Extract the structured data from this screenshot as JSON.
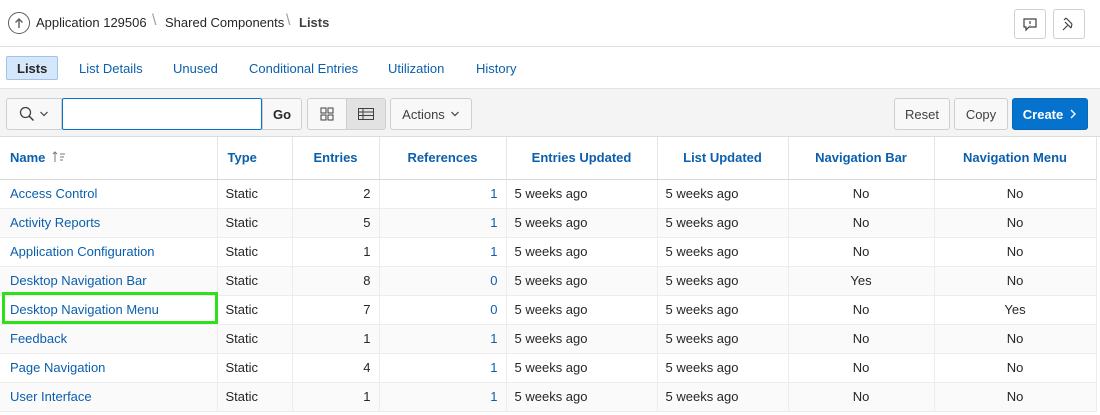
{
  "breadcrumb": {
    "items": [
      "Application 129506",
      "Shared Components",
      "Lists"
    ],
    "separator": "\\"
  },
  "header_icons": [
    "up-arrow-icon",
    "feedback-icon",
    "pin-icon"
  ],
  "tabs": [
    {
      "label": "Lists",
      "active": true
    },
    {
      "label": "List Details",
      "active": false
    },
    {
      "label": "Unused",
      "active": false
    },
    {
      "label": "Conditional Entries",
      "active": false
    },
    {
      "label": "Utilization",
      "active": false
    },
    {
      "label": "History",
      "active": false
    }
  ],
  "toolbar": {
    "search_value": "",
    "search_placeholder": "",
    "go_label": "Go",
    "actions_label": "Actions",
    "reset_label": "Reset",
    "copy_label": "Copy",
    "create_label": "Create",
    "view_mode": "report",
    "accent_color": "#0572ce"
  },
  "table": {
    "columns": [
      "Name",
      "Type",
      "Entries",
      "References",
      "Entries Updated",
      "List Updated",
      "Navigation Bar",
      "Navigation Menu"
    ],
    "sort_column": "Name",
    "sort_direction": "ascending",
    "rows": [
      {
        "name": "Access Control",
        "type": "Static",
        "entries": "2",
        "references": "1",
        "entries_updated": "5 weeks ago",
        "list_updated": "5 weeks ago",
        "nav_bar": "No",
        "nav_menu": "No"
      },
      {
        "name": "Activity Reports",
        "type": "Static",
        "entries": "5",
        "references": "1",
        "entries_updated": "5 weeks ago",
        "list_updated": "5 weeks ago",
        "nav_bar": "No",
        "nav_menu": "No"
      },
      {
        "name": "Application Configuration",
        "type": "Static",
        "entries": "1",
        "references": "1",
        "entries_updated": "5 weeks ago",
        "list_updated": "5 weeks ago",
        "nav_bar": "No",
        "nav_menu": "No"
      },
      {
        "name": "Desktop Navigation Bar",
        "type": "Static",
        "entries": "8",
        "references": "0",
        "entries_updated": "5 weeks ago",
        "list_updated": "5 weeks ago",
        "nav_bar": "Yes",
        "nav_menu": "No"
      },
      {
        "name": "Desktop Navigation Menu",
        "type": "Static",
        "entries": "7",
        "references": "0",
        "entries_updated": "5 weeks ago",
        "list_updated": "5 weeks ago",
        "nav_bar": "No",
        "nav_menu": "Yes",
        "highlighted": true
      },
      {
        "name": "Feedback",
        "type": "Static",
        "entries": "1",
        "references": "1",
        "entries_updated": "5 weeks ago",
        "list_updated": "5 weeks ago",
        "nav_bar": "No",
        "nav_menu": "No"
      },
      {
        "name": "Page Navigation",
        "type": "Static",
        "entries": "4",
        "references": "1",
        "entries_updated": "5 weeks ago",
        "list_updated": "5 weeks ago",
        "nav_bar": "No",
        "nav_menu": "No"
      },
      {
        "name": "User Interface",
        "type": "Static",
        "entries": "1",
        "references": "1",
        "entries_updated": "5 weeks ago",
        "list_updated": "5 weeks ago",
        "nav_bar": "No",
        "nav_menu": "No"
      }
    ]
  },
  "highlight_color": "#2ee01a"
}
